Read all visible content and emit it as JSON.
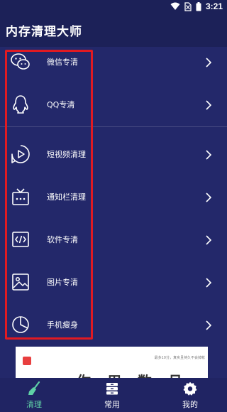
{
  "status_bar": {
    "time": "3:21",
    "icons": [
      "wifi-icon",
      "sim-blocked-icon",
      "battery-icon"
    ]
  },
  "header": {
    "title": "内存清理大师"
  },
  "menu": {
    "items": [
      {
        "label": "微信专清",
        "icon": "wechat-icon"
      },
      {
        "label": "QQ专清",
        "icon": "qq-penguin-icon"
      },
      {
        "label": "短视频清理",
        "icon": "play-icon"
      },
      {
        "label": "通知栏清理",
        "icon": "notification-bar-icon"
      },
      {
        "label": "软件专清",
        "icon": "code-icon"
      },
      {
        "label": "图片专清",
        "icon": "image-icon"
      },
      {
        "label": "手机瘦身",
        "icon": "pie-chart-icon"
      }
    ]
  },
  "ad": {
    "small_text": "最多10分，真实且持久不会掉帐",
    "big_text": "你 用 数 月 内"
  },
  "bottom_nav": {
    "items": [
      {
        "label": "清理",
        "icon": "broom-icon",
        "active": true
      },
      {
        "label": "常用",
        "icon": "stack-icon",
        "active": false
      },
      {
        "label": "我的",
        "icon": "gear-icon",
        "active": false
      }
    ]
  },
  "colors": {
    "background": "#23286a",
    "header": "#1c2158",
    "highlight": "#e01a22",
    "active_tab": "#5fd0a6"
  }
}
